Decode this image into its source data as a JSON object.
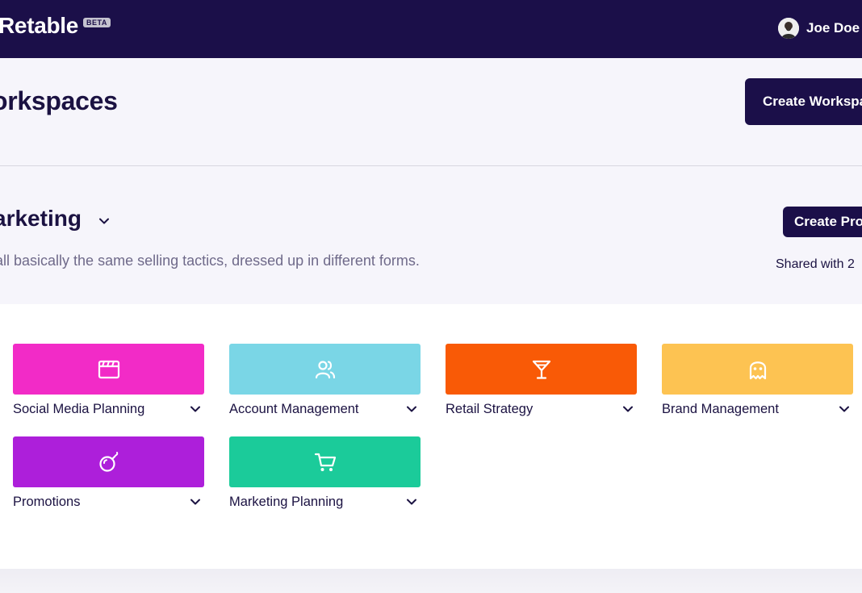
{
  "header": {
    "logo": "Retable",
    "beta_badge": "BETA",
    "user_name": "Joe Doe",
    "bg_color": "#1b0f49"
  },
  "page": {
    "title": "orkspaces",
    "create_workspace_label": "Create Workspac"
  },
  "workspace": {
    "name": "arketing",
    "description": "all basically the same selling tactics, dressed up in different forms.",
    "create_project_label": "Create Proj",
    "shared_text": "Shared with 2"
  },
  "projects": [
    {
      "name": "Social Media Planning",
      "color": "#f22bc7",
      "icon": "film-clapper-icon"
    },
    {
      "name": "Account Management",
      "color": "#7ad6e6",
      "icon": "users-icon"
    },
    {
      "name": "Retail Strategy",
      "color": "#f95a06",
      "icon": "cocktail-glass-icon"
    },
    {
      "name": "Brand Management",
      "color": "#fdc352",
      "icon": "ghost-icon"
    },
    {
      "name": "Promotions",
      "color": "#ad1fda",
      "icon": "bomb-icon"
    },
    {
      "name": "Marketing Planning",
      "color": "#1bcb9a",
      "icon": "shopping-cart-icon"
    }
  ]
}
